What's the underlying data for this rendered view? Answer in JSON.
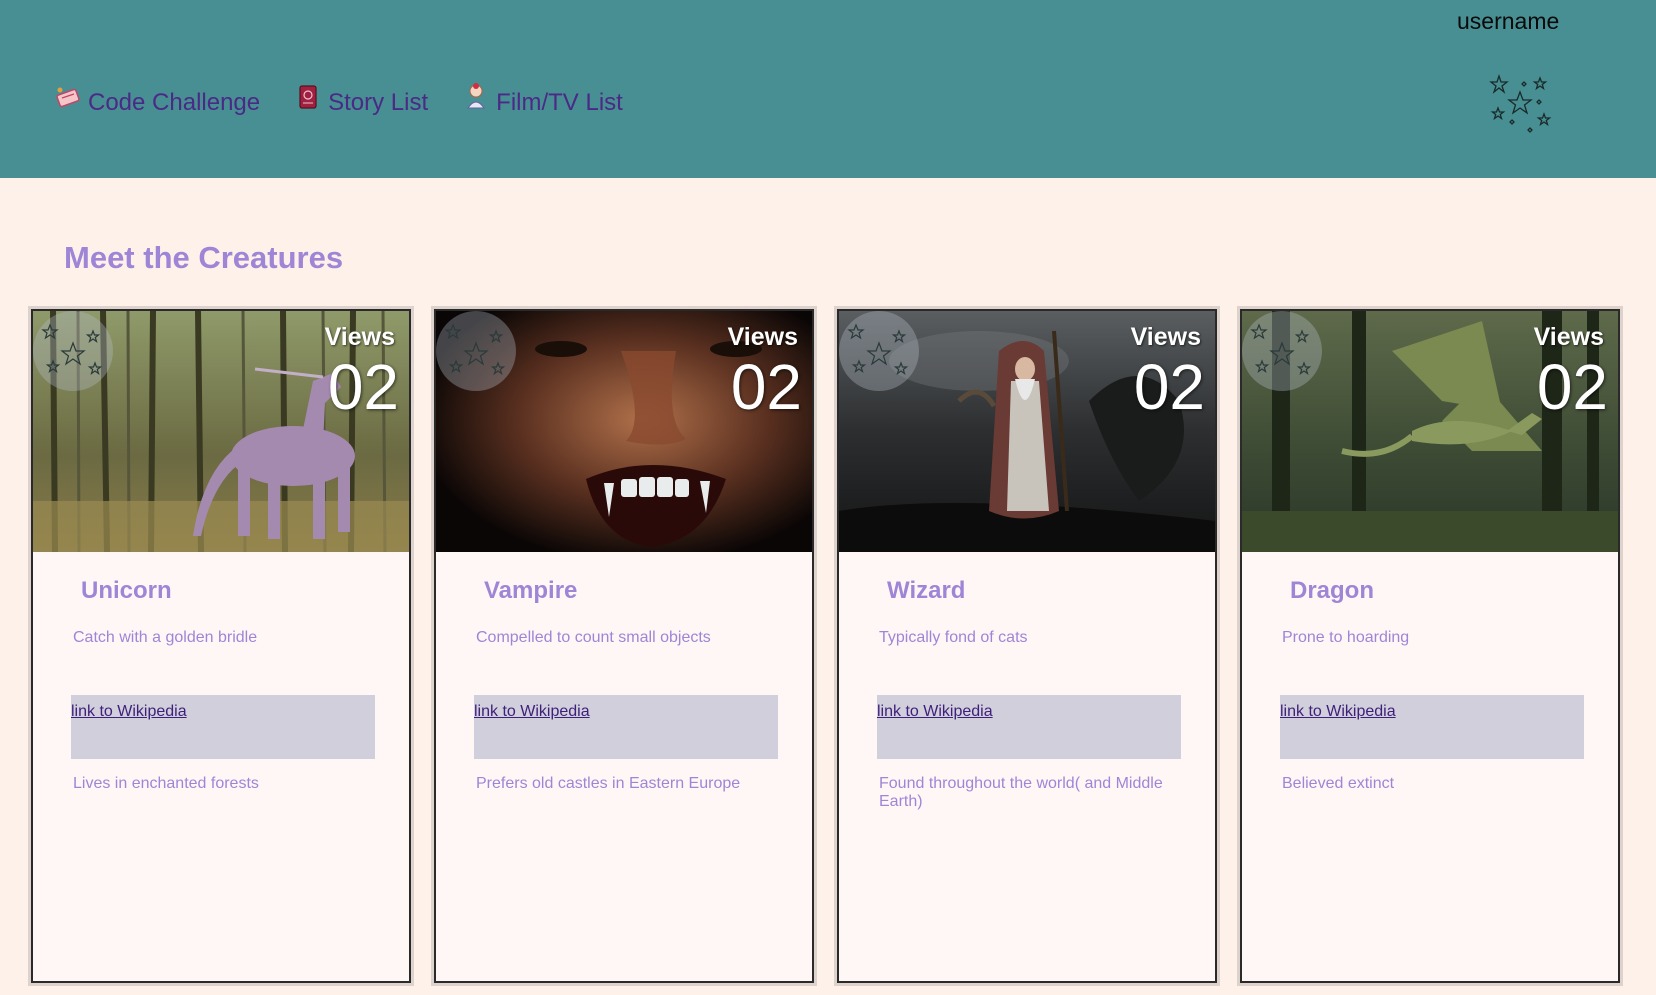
{
  "header": {
    "username": "username",
    "nav": [
      {
        "label": "Code Challenge",
        "icon": "code-scroll-icon"
      },
      {
        "label": "Story List",
        "icon": "book-icon"
      },
      {
        "label": "Film/TV List",
        "icon": "film-character-icon"
      }
    ],
    "stars_icon": "stars-icon",
    "colors": {
      "background": "#478f93",
      "nav_text": "#4b2a86"
    }
  },
  "main": {
    "title": "Meet the Creatures",
    "cards": [
      {
        "name": "Unicorn",
        "views_label": "Views",
        "views": "02",
        "fact": "Catch with a golden bridle",
        "link": "link to Wikipedia",
        "habitat": "Lives in enchanted forests"
      },
      {
        "name": "Vampire",
        "views_label": "Views",
        "views": "02",
        "fact": "Compelled to count small objects",
        "link": "link to Wikipedia",
        "habitat": "Prefers old castles in Eastern Europe"
      },
      {
        "name": "Wizard",
        "views_label": "Views",
        "views": "02",
        "fact": "Typically fond of cats",
        "link": "link to Wikipedia",
        "habitat": "Found throughout the world( and Middle Earth)"
      },
      {
        "name": "Dragon",
        "views_label": "Views",
        "views": "02",
        "fact": "Prone to hoarding",
        "link": "link to Wikipedia",
        "habitat": "Believed extinct"
      }
    ],
    "colors": {
      "title": "#9f85d6",
      "card_bg": "#fff7f6",
      "link_box": "#d1cfdc"
    }
  }
}
